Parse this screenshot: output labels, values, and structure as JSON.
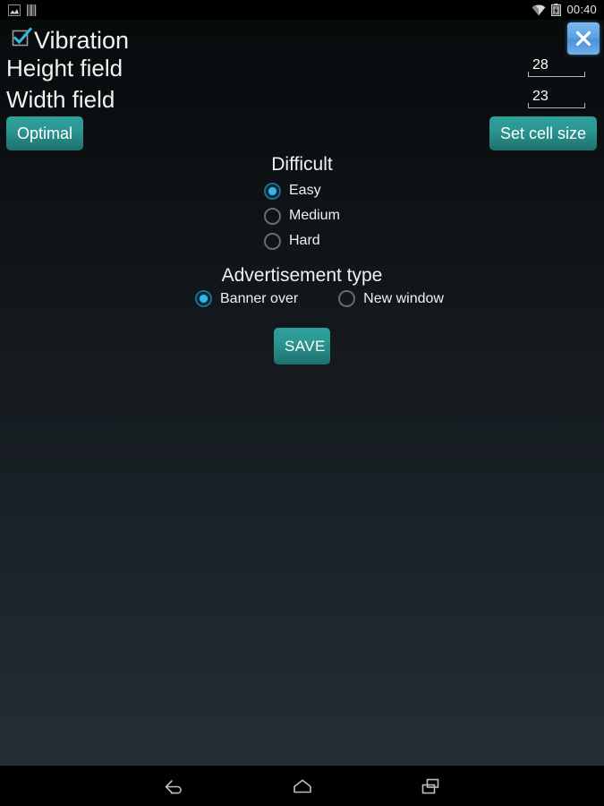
{
  "status_bar": {
    "left_icons": [
      "screenshot-icon",
      "barcode-icon"
    ],
    "right_icons": [
      "wifi-icon",
      "battery-charging-icon"
    ],
    "time": "00:40"
  },
  "header": {
    "vibration_label": "Vibration",
    "vibration_checked": true,
    "close_icon": "close-icon"
  },
  "fields": {
    "height": {
      "label": "Height field",
      "value": "28"
    },
    "width": {
      "label": "Width field",
      "value": "23"
    }
  },
  "buttons": {
    "optimal": "Optimal",
    "set_cell_size": "Set cell size",
    "save": "SAVE"
  },
  "difficulty": {
    "title": "Difficult",
    "selected": "Easy",
    "options": [
      {
        "label": "Easy",
        "selected": true
      },
      {
        "label": "Medium",
        "selected": false
      },
      {
        "label": "Hard",
        "selected": false
      }
    ]
  },
  "advertisement": {
    "title": "Advertisement type",
    "selected": "Banner over",
    "options": [
      {
        "label": "Banner over",
        "selected": true
      },
      {
        "label": "New window",
        "selected": false
      }
    ]
  },
  "navigation_bar": {
    "back": "back-icon",
    "home": "home-icon",
    "recents": "recents-icon"
  },
  "colors": {
    "accent_teal": "#2b9792",
    "accent_blue": "#33b5e5",
    "close_blue": "#5aa2e2",
    "text_primary": "#f2f2f2",
    "background_top": "#070a0b",
    "background_bottom": "#262f36"
  }
}
